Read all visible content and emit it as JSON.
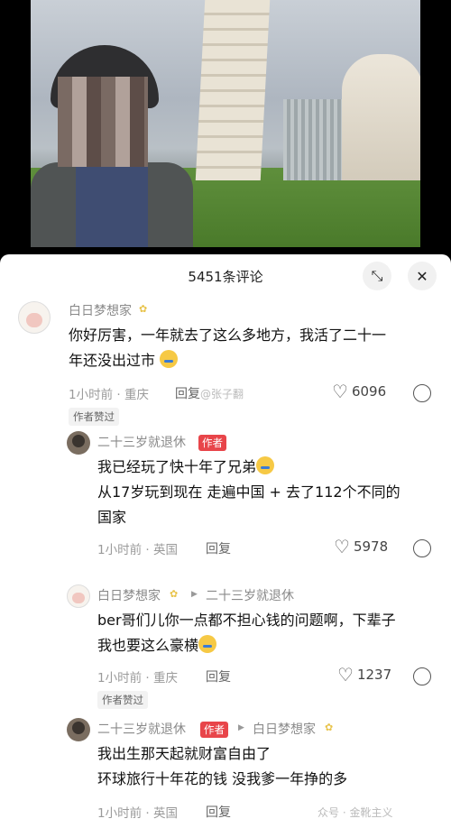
{
  "header": {
    "title": "5451条评论",
    "expand_icon": "expand-icon",
    "close_icon": "close-icon"
  },
  "watermark1": "@张子翻",
  "watermark2": "众号 · 金靴主义",
  "comments": [
    {
      "username": "白日梦想家",
      "text_line1": "你好厉害，一年就去了这么多地方，我活了二十一",
      "text_line2": "年还没出过市",
      "time": "1小时前",
      "location": "重庆",
      "reply": "回复",
      "likes": "6096",
      "badge": "作者赞过"
    },
    {
      "username": "二十三岁就退休",
      "author_tag": "作者",
      "text_line1": "我已经玩了快十年了兄弟",
      "text_line2": "从17岁玩到现在  走遍中国 + 去了112个不同的",
      "text_line3": "国家",
      "time": "1小时前",
      "location": "英国",
      "reply": "回复",
      "likes": "5978"
    },
    {
      "username": "白日梦想家",
      "reply_to": "二十三岁就退休",
      "text_line1": "ber哥们儿你一点都不担心钱的问题啊，下辈子",
      "text_line2": "我也要这么豪横",
      "time": "1小时前",
      "location": "重庆",
      "reply": "回复",
      "likes": "1237",
      "badge": "作者赞过"
    },
    {
      "username": "二十三岁就退休",
      "author_tag": "作者",
      "reply_to": "白日梦想家",
      "text_line1": "我出生那天起就财富自由了",
      "text_line2": "环球旅行十年花的钱 没我爹一年挣的多",
      "time": "1小时前",
      "location": "英国",
      "reply": "回复"
    }
  ]
}
